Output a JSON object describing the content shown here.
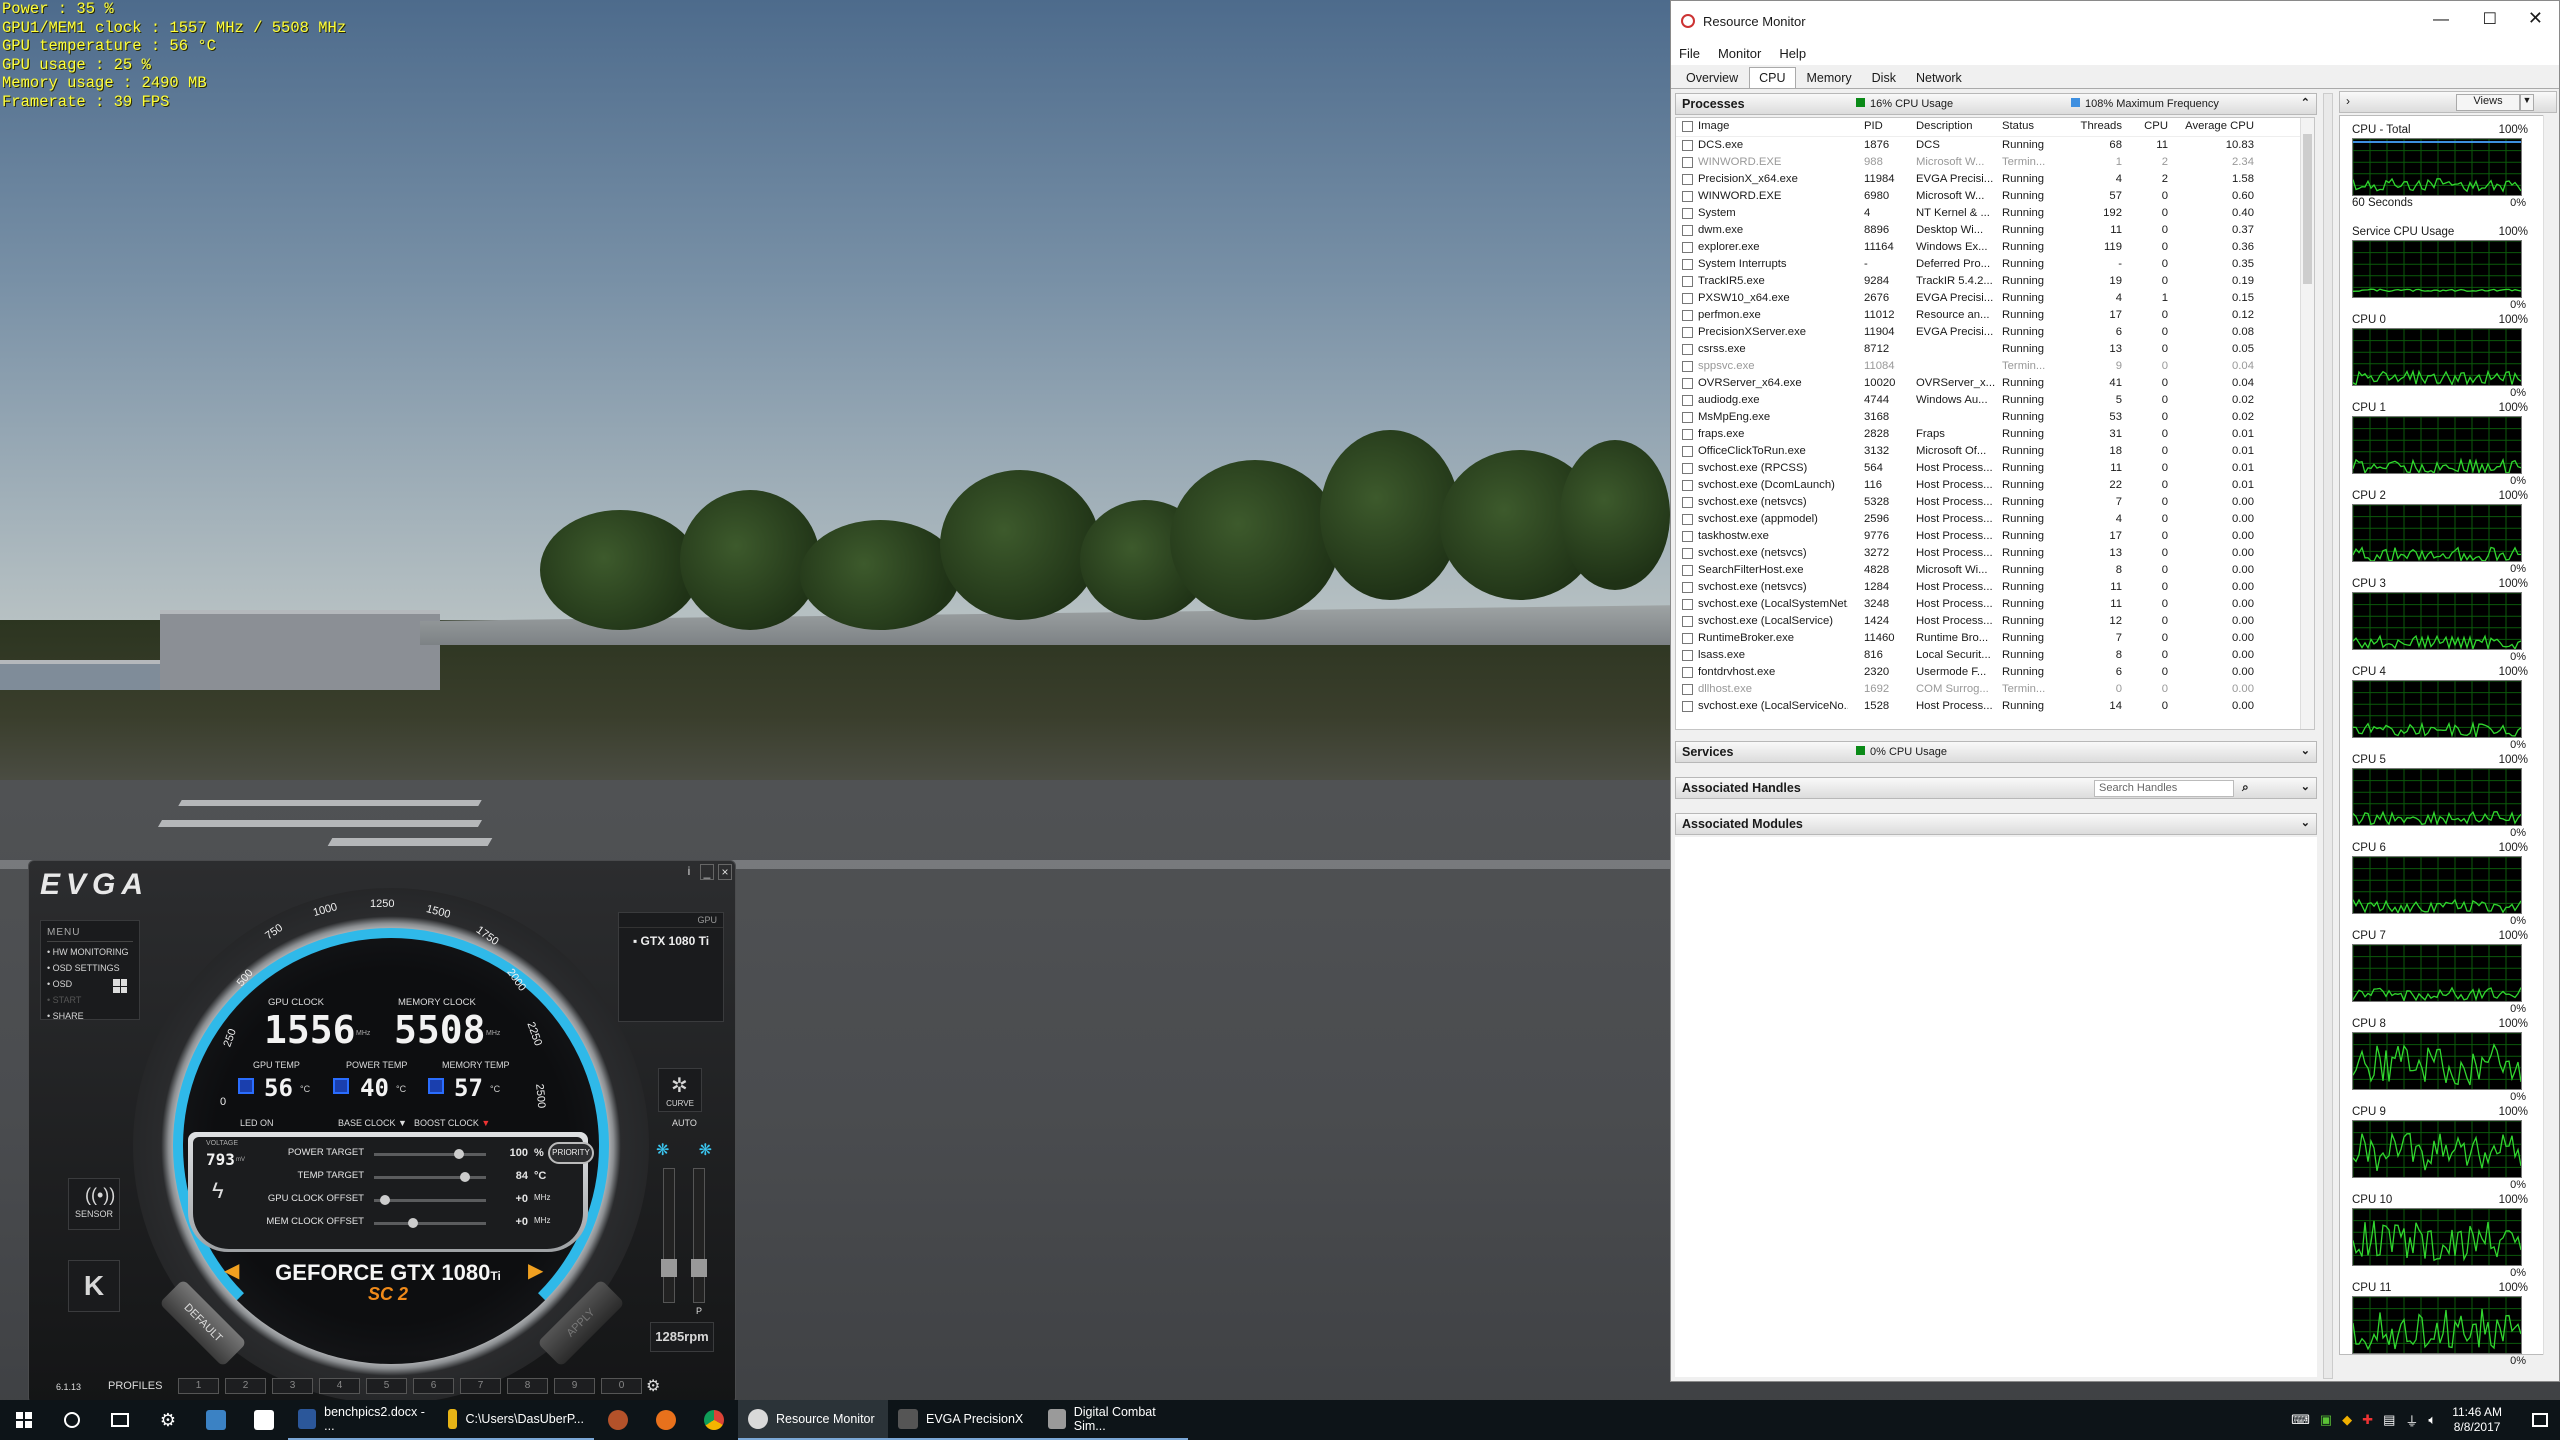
{
  "osd": {
    "lines": [
      "Power : 35 %",
      "GPU1/MEM1 clock : 1557 MHz / 5508 MHz",
      "GPU temperature : 56 °C",
      "GPU usage : 25 %",
      "Memory usage : 2490 MB",
      "Framerate : 39 FPS"
    ]
  },
  "evga": {
    "logo": "EVGA",
    "menu_title": "MENU",
    "menu_items": [
      "HW MONITORING",
      "OSD SETTINGS",
      "OSD",
      "START",
      "SHARE"
    ],
    "gpu_tag": "GPU",
    "gpu_name": "GTX 1080 Ti",
    "gpu_clock_label": "GPU CLOCK",
    "gpu_clock": "1556",
    "mem_clock_label": "MEMORY CLOCK",
    "mem_clock": "5508",
    "unit_mhz": "MHz",
    "gpu_temp_label": "GPU TEMP",
    "gpu_temp": "56",
    "power_temp_label": "POWER TEMP",
    "power_temp": "40",
    "mem_temp_label": "MEMORY TEMP",
    "mem_temp": "57",
    "deg": "°C",
    "led_on": "LED ON",
    "base_clock": "BASE CLOCK",
    "boost_clock": "BOOST CLOCK",
    "scale": [
      "0",
      "250",
      "500",
      "750",
      "1000",
      "1250",
      "1500",
      "1750",
      "2000",
      "2250",
      "2500"
    ],
    "voltage_label": "VOLTAGE",
    "voltage": "793",
    "voltage_unit": "mV",
    "power_target_label": "POWER TARGET",
    "power_target": "100",
    "power_target_unit": "%",
    "temp_target_label": "TEMP TARGET",
    "temp_target": "84",
    "temp_target_unit": "°C",
    "gpu_offset_label": "GPU CLOCK OFFSET",
    "gpu_offset": "+0",
    "mem_offset_label": "MEM CLOCK OFFSET",
    "mem_offset": "+0",
    "priority": "PRIORITY",
    "card_name": "GEFORCE GTX 1080",
    "card_ti": "Ti",
    "card_sub": "SC 2",
    "default_btn": "DEFAULT",
    "apply_btn": "APPLY",
    "sensor": "SENSOR",
    "curve": "CURVE",
    "auto": "AUTO",
    "fan_rpm": "1285rpm",
    "version": "6.1.13",
    "profiles_label": "PROFILES",
    "profiles": [
      "1",
      "2",
      "3",
      "4",
      "5",
      "6",
      "7",
      "8",
      "9",
      "0"
    ],
    "fan_slider_p": "P",
    "win_min": "_",
    "win_close": "×",
    "win_info": "i"
  },
  "rm": {
    "title": "Resource Monitor",
    "menu": [
      "File",
      "Monitor",
      "Help"
    ],
    "tabs": [
      "Overview",
      "CPU",
      "Memory",
      "Disk",
      "Network"
    ],
    "processes_hdr": "Processes",
    "cpu_usage": "16% CPU Usage",
    "max_freq": "108% Maximum Frequency",
    "columns": [
      "Image",
      "PID",
      "Description",
      "Status",
      "Threads",
      "CPU",
      "Average CPU"
    ],
    "rows": [
      [
        "DCS.exe",
        "1876",
        "DCS",
        "Running",
        "68",
        "11",
        "10.83"
      ],
      [
        "WINWORD.EXE",
        "988",
        "Microsoft W...",
        "Termin...",
        "1",
        "2",
        "2.34"
      ],
      [
        "PrecisionX_x64.exe",
        "11984",
        "EVGA Precisi...",
        "Running",
        "4",
        "2",
        "1.58"
      ],
      [
        "WINWORD.EXE",
        "6980",
        "Microsoft W...",
        "Running",
        "57",
        "0",
        "0.60"
      ],
      [
        "System",
        "4",
        "NT Kernel & ...",
        "Running",
        "192",
        "0",
        "0.40"
      ],
      [
        "dwm.exe",
        "8896",
        "Desktop Wi...",
        "Running",
        "11",
        "0",
        "0.37"
      ],
      [
        "explorer.exe",
        "11164",
        "Windows Ex...",
        "Running",
        "119",
        "0",
        "0.36"
      ],
      [
        "System Interrupts",
        "-",
        "Deferred Pro...",
        "Running",
        "-",
        "0",
        "0.35"
      ],
      [
        "TrackIR5.exe",
        "9284",
        "TrackIR 5.4.2...",
        "Running",
        "19",
        "0",
        "0.19"
      ],
      [
        "PXSW10_x64.exe",
        "2676",
        "EVGA Precisi...",
        "Running",
        "4",
        "1",
        "0.15"
      ],
      [
        "perfmon.exe",
        "11012",
        "Resource an...",
        "Running",
        "17",
        "0",
        "0.12"
      ],
      [
        "PrecisionXServer.exe",
        "11904",
        "EVGA Precisi...",
        "Running",
        "6",
        "0",
        "0.08"
      ],
      [
        "csrss.exe",
        "8712",
        "",
        "Running",
        "13",
        "0",
        "0.05"
      ],
      [
        "sppsvc.exe",
        "11084",
        "",
        "Termin...",
        "9",
        "0",
        "0.04"
      ],
      [
        "OVRServer_x64.exe",
        "10020",
        "OVRServer_x...",
        "Running",
        "41",
        "0",
        "0.04"
      ],
      [
        "audiodg.exe",
        "4744",
        "Windows Au...",
        "Running",
        "5",
        "0",
        "0.02"
      ],
      [
        "MsMpEng.exe",
        "3168",
        "",
        "Running",
        "53",
        "0",
        "0.02"
      ],
      [
        "fraps.exe",
        "2828",
        "Fraps",
        "Running",
        "31",
        "0",
        "0.01"
      ],
      [
        "OfficeClickToRun.exe",
        "3132",
        "Microsoft Of...",
        "Running",
        "18",
        "0",
        "0.01"
      ],
      [
        "svchost.exe (RPCSS)",
        "564",
        "Host Process...",
        "Running",
        "11",
        "0",
        "0.01"
      ],
      [
        "svchost.exe (DcomLaunch)",
        "116",
        "Host Process...",
        "Running",
        "22",
        "0",
        "0.01"
      ],
      [
        "svchost.exe (netsvcs)",
        "5328",
        "Host Process...",
        "Running",
        "7",
        "0",
        "0.00"
      ],
      [
        "svchost.exe (appmodel)",
        "2596",
        "Host Process...",
        "Running",
        "4",
        "0",
        "0.00"
      ],
      [
        "taskhostw.exe",
        "9776",
        "Host Process...",
        "Running",
        "17",
        "0",
        "0.00"
      ],
      [
        "svchost.exe (netsvcs)",
        "3272",
        "Host Process...",
        "Running",
        "13",
        "0",
        "0.00"
      ],
      [
        "SearchFilterHost.exe",
        "4828",
        "Microsoft Wi...",
        "Running",
        "8",
        "0",
        "0.00"
      ],
      [
        "svchost.exe (netsvcs)",
        "1284",
        "Host Process...",
        "Running",
        "11",
        "0",
        "0.00"
      ],
      [
        "svchost.exe (LocalSystemNet...",
        "3248",
        "Host Process...",
        "Running",
        "11",
        "0",
        "0.00"
      ],
      [
        "svchost.exe (LocalService)",
        "1424",
        "Host Process...",
        "Running",
        "12",
        "0",
        "0.00"
      ],
      [
        "RuntimeBroker.exe",
        "11460",
        "Runtime Bro...",
        "Running",
        "7",
        "0",
        "0.00"
      ],
      [
        "lsass.exe",
        "816",
        "Local Securit...",
        "Running",
        "8",
        "0",
        "0.00"
      ],
      [
        "fontdrvhost.exe",
        "2320",
        "Usermode F...",
        "Running",
        "6",
        "0",
        "0.00"
      ],
      [
        "dllhost.exe",
        "1692",
        "COM Surrog...",
        "Termin...",
        "0",
        "0",
        "0.00"
      ],
      [
        "svchost.exe (LocalServiceNo...",
        "1528",
        "Host Process...",
        "Running",
        "14",
        "0",
        "0.00"
      ]
    ],
    "services_hdr": "Services",
    "services_usage": "0% CPU Usage",
    "handles_hdr": "Associated Handles",
    "search_handles": "Search Handles",
    "modules_hdr": "Associated Modules",
    "views": "Views",
    "graphs": [
      {
        "title": "CPU - Total",
        "max": "100%",
        "min": "0%"
      },
      {
        "title": "Service CPU Usage",
        "max": "100%",
        "min": "0%"
      },
      {
        "title": "CPU 0",
        "max": "100%",
        "min": "0%"
      },
      {
        "title": "CPU 1",
        "max": "100%",
        "min": "0%"
      },
      {
        "title": "CPU 2",
        "max": "100%",
        "min": "0%"
      },
      {
        "title": "CPU 3",
        "max": "100%",
        "min": "0%"
      },
      {
        "title": "CPU 4",
        "max": "100%",
        "min": "0%"
      },
      {
        "title": "CPU 5",
        "max": "100%",
        "min": "0%"
      },
      {
        "title": "CPU 6",
        "max": "100%",
        "min": "0%"
      },
      {
        "title": "CPU 7",
        "max": "100%",
        "min": "0%"
      },
      {
        "title": "CPU 8",
        "max": "100%",
        "min": "0%"
      },
      {
        "title": "CPU 9",
        "max": "100%",
        "min": "0%"
      },
      {
        "title": "CPU 10",
        "max": "100%",
        "min": "0%"
      },
      {
        "title": "CPU 11",
        "max": "100%",
        "min": "0%"
      }
    ],
    "sixty_seconds": "60 Seconds"
  },
  "taskbar": {
    "apps": [
      {
        "label": "benchpics2.docx - ...",
        "color": "#2b579a"
      },
      {
        "label": "C:\\Users\\DasUberP...",
        "color": "#e7b416"
      },
      {
        "label": "Resource Monitor",
        "color": "#d9d9d9"
      },
      {
        "label": "EVGA PrecisionX",
        "color": "#555555"
      },
      {
        "label": "Digital Combat Sim...",
        "color": "#9a9a9a"
      }
    ],
    "time": "11:46 AM",
    "date": "8/8/2017"
  }
}
